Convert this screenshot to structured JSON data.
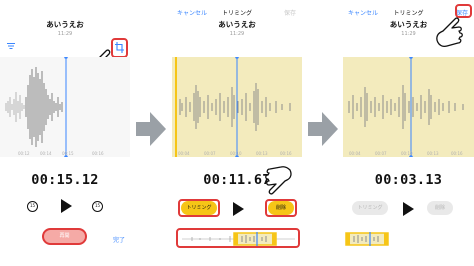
{
  "panel1": {
    "name": "あいうえお",
    "date": "11:29",
    "timeline": [
      "00:12",
      "00:14",
      "00:15",
      "00:16"
    ],
    "time": "00:15.12",
    "skip_back": "15",
    "skip_fwd": "15",
    "pause_label": "再開",
    "done_label": "完了"
  },
  "panel2": {
    "cancel_label": "キャンセル",
    "title": "トリミング",
    "save_label": "保存",
    "name": "あいうえお",
    "date": "11:29",
    "timeline": [
      "00:04",
      "00:07",
      "00:10",
      "00:13",
      "00:16"
    ],
    "time": "00:11.67",
    "trim_label": "トリミング",
    "delete_label": "削除"
  },
  "panel3": {
    "cancel_label": "キャンセル",
    "title": "トリミング",
    "save_label": "保存",
    "name": "あいうえお",
    "date": "11:29",
    "timeline": [
      "00:04",
      "00:07",
      "00:10",
      "00:13",
      "00:16"
    ],
    "time": "00:03.13",
    "trim_label": "トリミング",
    "delete_label": "削除"
  },
  "colors": {
    "accent_blue": "#3a86ff",
    "trim_yellow": "#f6c517",
    "highlight_red": "#e03a3a",
    "selection_bg": "#f3ebbd"
  },
  "icons": [
    "filter-icon",
    "trim-icon",
    "play-icon",
    "skip-back-15-icon",
    "skip-forward-15-icon",
    "arrow-right-icon",
    "pointing-hand-icon"
  ]
}
